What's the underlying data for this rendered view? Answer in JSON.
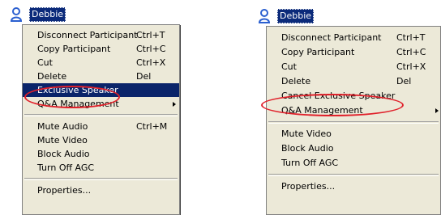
{
  "left": {
    "user_name": "Debbie",
    "items": [
      {
        "label": "Disconnect Participant",
        "shortcut": "Ctrl+T"
      },
      {
        "label": "Copy Participant",
        "shortcut": "Ctrl+C"
      },
      {
        "label": "Cut",
        "shortcut": "Ctrl+X"
      },
      {
        "label": "Delete",
        "shortcut": "Del"
      },
      {
        "label": "Exclusive Speaker",
        "shortcut": ""
      },
      {
        "label": "Q&A Management",
        "shortcut": ""
      },
      {
        "label": "Mute Audio",
        "shortcut": "Ctrl+M"
      },
      {
        "label": "Mute Video",
        "shortcut": ""
      },
      {
        "label": "Block Audio",
        "shortcut": ""
      },
      {
        "label": "Turn Off AGC",
        "shortcut": ""
      },
      {
        "label": "Properties...",
        "shortcut": ""
      }
    ]
  },
  "right": {
    "user_name": "Debbie",
    "items": [
      {
        "label": "Disconnect Participant",
        "shortcut": "Ctrl+T"
      },
      {
        "label": "Copy Participant",
        "shortcut": "Ctrl+C"
      },
      {
        "label": "Cut",
        "shortcut": "Ctrl+X"
      },
      {
        "label": "Delete",
        "shortcut": "Del"
      },
      {
        "label": "Cancel Exclusive Speaker",
        "shortcut": ""
      },
      {
        "label": "Q&A Management",
        "shortcut": ""
      },
      {
        "label": "Mute Video",
        "shortcut": ""
      },
      {
        "label": "Block Audio",
        "shortcut": ""
      },
      {
        "label": "Turn Off AGC",
        "shortcut": ""
      },
      {
        "label": "Properties...",
        "shortcut": ""
      }
    ]
  },
  "colors": {
    "menu_bg": "#ece9d8",
    "highlight": "#0a246a",
    "annotation": "#e0202a",
    "user_icon": "#2a5fd0"
  },
  "icons": {
    "user": "person-icon",
    "submenu": "submenu-arrow-icon"
  }
}
